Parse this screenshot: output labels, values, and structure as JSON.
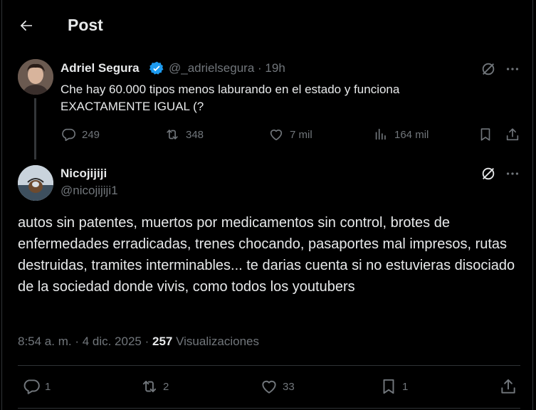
{
  "header": {
    "title": "Post"
  },
  "parent_tweet": {
    "author_name": "Adriel Segura",
    "handle": "@_adrielsegura",
    "separator": "·",
    "time": "19h",
    "text": "Che hay 60.000 tipos menos laburando en el estado y funciona EXACTAMENTE IGUAL (?",
    "replies": "249",
    "reposts": "348",
    "likes": "7 mil",
    "views": "164 mil"
  },
  "reply_tweet": {
    "author_name": "Nicojijiji",
    "handle": "@nicojijiji1",
    "text": "autos sin patentes, muertos por medicamentos sin control, brotes de enfermedades erradicadas, trenes chocando, pasaportes mal impresos, rutas destruidas, tramites interminables... te darias cuenta si no estuvieras disociado de la sociedad donde vivis, como todos los youtubers",
    "timestamp": "8:54 a. m. · 4 dic. 2025 ·",
    "views_count": "257",
    "views_label": "Visualizaciones",
    "replies": "1",
    "reposts": "2",
    "likes": "33",
    "bookmarks": "1"
  },
  "colors": {
    "background": "#000000",
    "text": "#e7e9ea",
    "muted": "#71767b",
    "verified": "#1d9bf0",
    "divider": "#2f3336"
  }
}
